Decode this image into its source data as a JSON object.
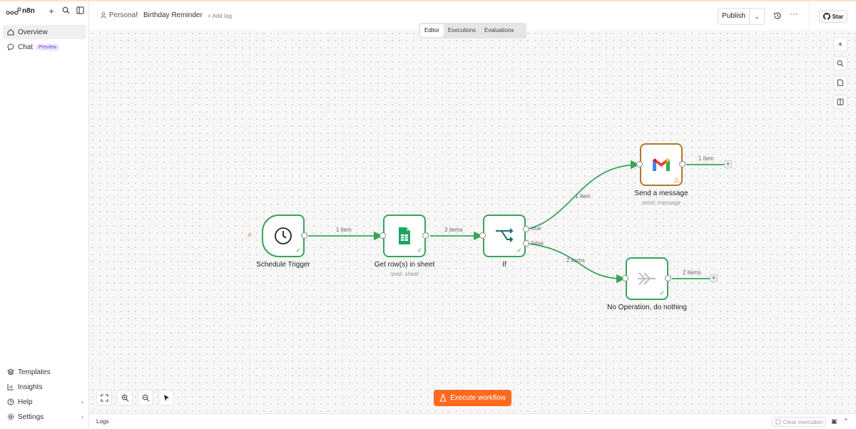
{
  "app": {
    "name": "n8n"
  },
  "sidebar": {
    "top_items": [
      {
        "label": "Overview",
        "icon": "home-icon"
      },
      {
        "label": "Chat",
        "icon": "chat-icon",
        "badge": "Preview"
      }
    ],
    "bottom_items": [
      {
        "label": "Templates",
        "icon": "templates-icon"
      },
      {
        "label": "Insights",
        "icon": "insights-icon"
      },
      {
        "label": "Help",
        "icon": "help-icon"
      },
      {
        "label": "Settings",
        "icon": "settings-icon"
      }
    ]
  },
  "header": {
    "project": "Personal",
    "workflow_title": "Birthday Reminder",
    "add_tag": "+ Add tag",
    "publish_label": "Publish",
    "star_label": "Star"
  },
  "tabs": [
    {
      "label": "Editor",
      "active": true
    },
    {
      "label": "Executions",
      "active": false
    },
    {
      "label": "Evaluations",
      "active": false
    }
  ],
  "nodes": {
    "schedule": {
      "label": "Schedule Trigger",
      "icon": "clock-icon"
    },
    "sheet": {
      "label": "Get row(s) in sheet",
      "sub": "read: sheet",
      "icon": "google-sheets-icon"
    },
    "if": {
      "label": "If",
      "icon": "if-branch-icon",
      "out_true": "true",
      "out_false": "false"
    },
    "gmail": {
      "label": "Send a message",
      "sub": "send: message",
      "icon": "gmail-icon"
    },
    "noop": {
      "label": "No Operation, do nothing",
      "icon": "noop-arrows-icon"
    }
  },
  "edges": {
    "schedule_sheet": "1 item",
    "sheet_if": "3 items",
    "if_gmail": "1 item",
    "if_noop": "2 items",
    "gmail_out": "1 item",
    "noop_out": "2 items"
  },
  "execute_button": "Execute workflow",
  "logs": {
    "label": "Logs",
    "clear_label": "Clear execution"
  },
  "colors": {
    "success": "#37a55a",
    "accent": "#ff6a1f",
    "warning": "#b5762b"
  }
}
